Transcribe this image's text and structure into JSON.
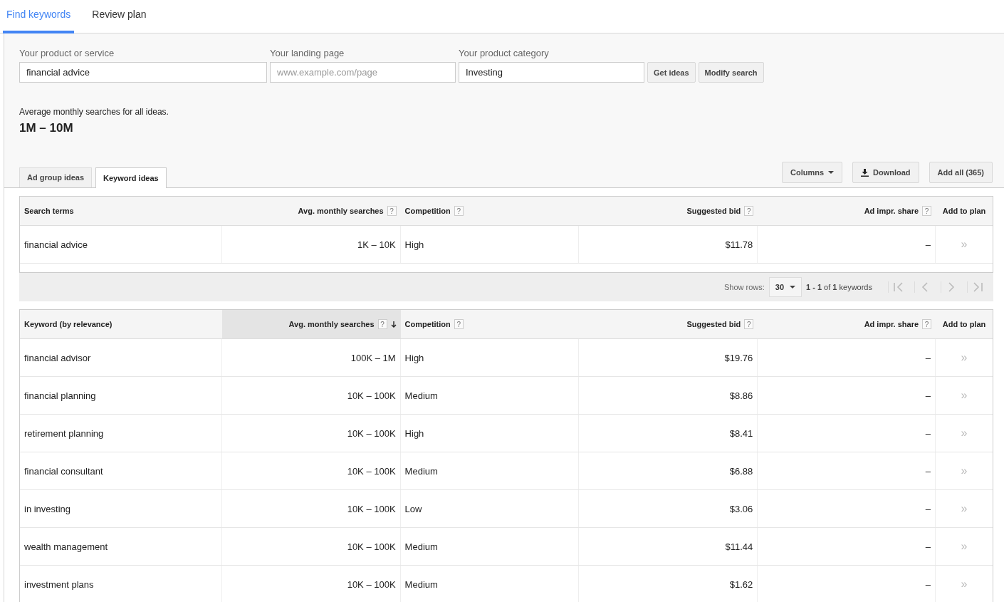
{
  "nav_tabs": [
    {
      "label": "Find keywords",
      "selected": true
    },
    {
      "label": "Review plan",
      "selected": false
    }
  ],
  "form": {
    "fields": [
      {
        "label": "Your product or service",
        "value": "financial advice"
      },
      {
        "label": "Your landing page",
        "placeholder": "www.example.com/page"
      },
      {
        "label": "Your product category",
        "value": "Investing"
      }
    ],
    "buttons": [
      "Get ideas",
      "Modify search"
    ]
  },
  "summary": {
    "caption": "Average monthly searches for all ideas.",
    "range": "1M – 10M"
  },
  "idea_tabs": [
    {
      "label": "Ad group ideas",
      "selected": false
    },
    {
      "label": "Keyword ideas",
      "selected": true
    }
  ],
  "toolbar": {
    "columns": "Columns",
    "download": "Download",
    "add_all": "Add all (365)"
  },
  "search_terms_table": {
    "columns": [
      {
        "label": "Search terms",
        "sorted": false
      },
      {
        "label": "Avg. monthly searches",
        "help": "?",
        "sorted": false
      },
      {
        "label": "Competition",
        "help": "?",
        "sorted": false
      },
      {
        "label": "Suggested bid",
        "help": "?",
        "sorted": false
      },
      {
        "label": "Ad impr. share",
        "help": "?",
        "sorted": false
      },
      {
        "label": "Add to plan",
        "sorted": false
      }
    ],
    "rows": [
      {
        "term": "financial advice",
        "searches": "1K – 10K",
        "competition": "High",
        "bid": "$11.78",
        "share": "–",
        "add": "»"
      }
    ]
  },
  "pager": {
    "show_rows_label": "Show rows:",
    "rows_value": "30",
    "range": "**1 - 1** of **1** keywords"
  },
  "keyword_table": {
    "columns": [
      {
        "label": "Keyword (by relevance)",
        "sorted": false
      },
      {
        "label": "Avg. monthly searches",
        "help": "?",
        "sorted": true
      },
      {
        "label": "Competition",
        "help": "?",
        "sorted": false
      },
      {
        "label": "Suggested bid",
        "help": "?",
        "sorted": false
      },
      {
        "label": "Ad impr. share",
        "help": "?",
        "sorted": false
      },
      {
        "label": "Add to plan",
        "sorted": false
      }
    ],
    "rows": [
      {
        "term": "financial advisor",
        "searches": "100K – 1M",
        "competition": "High",
        "bid": "$19.76",
        "share": "–",
        "add": "»"
      },
      {
        "term": "financial planning",
        "searches": "10K – 100K",
        "competition": "Medium",
        "bid": "$8.86",
        "share": "–",
        "add": "»"
      },
      {
        "term": "retirement planning",
        "searches": "10K – 100K",
        "competition": "High",
        "bid": "$8.41",
        "share": "–",
        "add": "»"
      },
      {
        "term": "financial consultant",
        "searches": "10K – 100K",
        "competition": "Medium",
        "bid": "$6.88",
        "share": "–",
        "add": "»"
      },
      {
        "term": "in investing",
        "searches": "10K – 100K",
        "competition": "Low",
        "bid": "$3.06",
        "share": "–",
        "add": "»"
      },
      {
        "term": "wealth management",
        "searches": "10K – 100K",
        "competition": "Medium",
        "bid": "$11.44",
        "share": "–",
        "add": "»"
      },
      {
        "term": "investment plans",
        "searches": "10K – 100K",
        "competition": "Medium",
        "bid": "$1.62",
        "share": "–",
        "add": "»"
      }
    ]
  }
}
